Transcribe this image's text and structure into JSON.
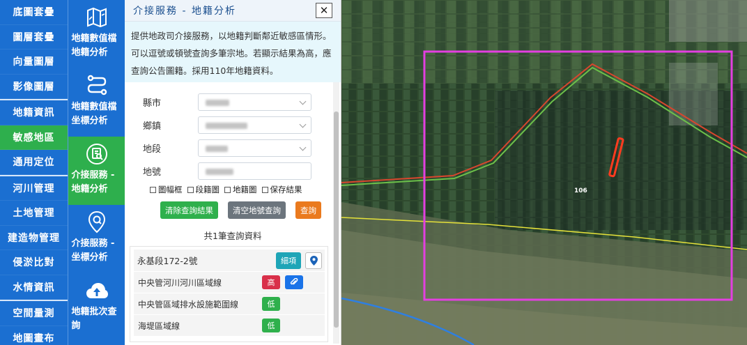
{
  "nav_primary": [
    {
      "label": "底圖套疊"
    },
    {
      "label": "圖層套疊"
    },
    {
      "label": "向量圖層"
    },
    {
      "label": "影像圖層"
    },
    {
      "label": "地籍資訊"
    },
    {
      "label": "敏感地區",
      "active": true
    },
    {
      "label": "通用定位"
    },
    {
      "label": "河川管理"
    },
    {
      "label": "土地管理"
    },
    {
      "label": "建造物管理"
    },
    {
      "label": "侵淤比對"
    },
    {
      "label": "水情資訊"
    },
    {
      "label": "空間量測"
    },
    {
      "label": "地圖畫布"
    }
  ],
  "nav_secondary": [
    {
      "label": "地籍數值檔地籍分析",
      "icon": "map-icon"
    },
    {
      "label": "地籍數值檔坐標分析",
      "icon": "route-icon"
    },
    {
      "label": "介接服務 - 地籍分析",
      "icon": "document-search-icon",
      "active": true
    },
    {
      "label": "介接服務 - 坐標分析",
      "icon": "location-search-icon"
    },
    {
      "label": "地籍批次查詢",
      "icon": "cloud-upload-icon"
    }
  ],
  "panel": {
    "title": "介接服務 - 地籍分析",
    "close": "✕",
    "description": "提供地政司介接服務，以地籍判斷鄰近敏感區情形。可以逗號或頓號查詢多筆宗地。若顯示結果為高，應查詢公告圖籍。採用110年地籍資料。",
    "fields": {
      "county_label": "縣市",
      "township_label": "鄉鎮",
      "section_label": "地段",
      "parcel_label": "地號"
    },
    "checkboxes": [
      "圖幅框",
      "段籍圖",
      "地籍圖",
      "保存結果"
    ],
    "buttons": {
      "clear_results": "清除查詢結果",
      "clear_parcel": "清空地號查詢",
      "query": "查詢"
    },
    "result_count": "共1筆查詢資料",
    "result": {
      "parcel": "永基段172-2號",
      "detail_button": "細項",
      "items": [
        {
          "name": "中央管河川河川區域線",
          "level": "高",
          "level_type": "high",
          "attachment": true
        },
        {
          "name": "中央管區域排水設施範圍線",
          "level": "低",
          "level_type": "low"
        },
        {
          "name": "海堤區域線",
          "level": "低",
          "level_type": "low"
        }
      ]
    }
  },
  "map": {
    "label": "106",
    "colors": {
      "frame": "#e33fe0",
      "parcel": "#ff3b1f",
      "route_red": "#d9462e",
      "route_green": "#6cc04a",
      "line_yellow": "#e6e23a",
      "river_blue": "#2f7fe0"
    }
  },
  "colors": {
    "nav_blue": "#1b6fd1",
    "active_green": "#2eaf4d"
  }
}
